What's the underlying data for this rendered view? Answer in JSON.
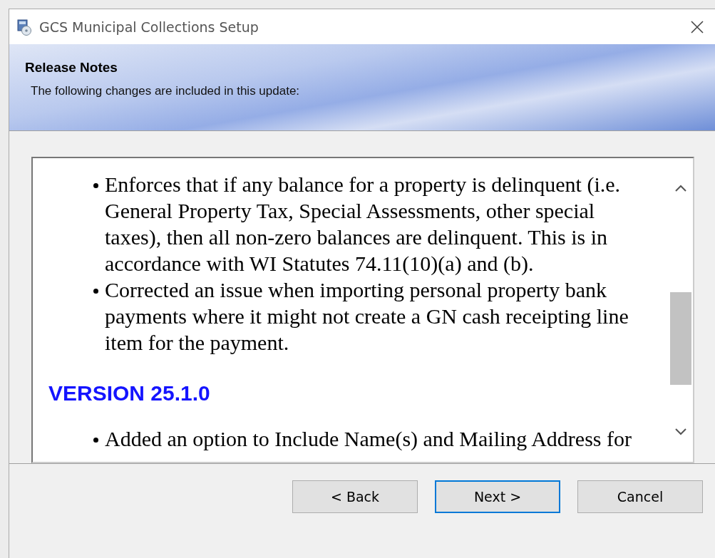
{
  "window": {
    "title": "GCS Municipal Collections Setup"
  },
  "header": {
    "title": "Release Notes",
    "subtitle": "The following changes are included in this update:"
  },
  "notes": [
    {
      "kind": "bullet",
      "text": "Enforces that if any balance for a property is delinquent (i.e. General Property Tax, Special Assessments, other special taxes), then all non-zero balances are delinquent. This is in accordance with WI Statutes 74.11(10)(a) and (b)."
    },
    {
      "kind": "bullet",
      "text": "Corrected an issue when importing personal property bank payments where it might not create a GN cash receipting line item for the payment."
    },
    {
      "kind": "heading",
      "text": "VERSION 25.1.0"
    },
    {
      "kind": "bullet",
      "text": "Added an option to Include Name(s) and Mailing Address for"
    }
  ],
  "buttons": [
    {
      "label": "< Back",
      "default": false
    },
    {
      "label": "Next >",
      "default": true
    },
    {
      "label": "Cancel",
      "default": false
    }
  ]
}
